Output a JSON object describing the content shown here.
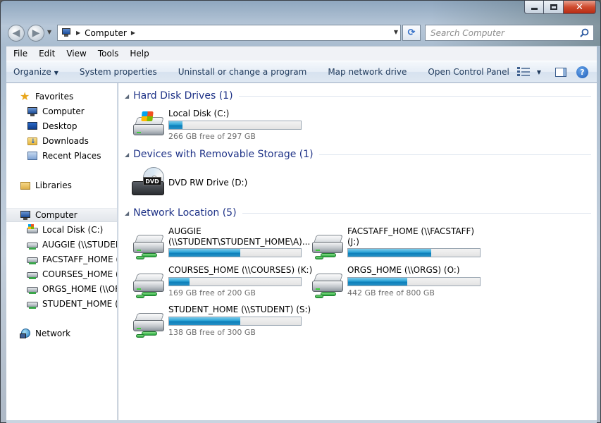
{
  "window": {
    "address": {
      "location": "Computer"
    },
    "search": {
      "placeholder": "Search Computer"
    }
  },
  "menu": [
    "File",
    "Edit",
    "View",
    "Tools",
    "Help"
  ],
  "toolbar": {
    "organize": "Organize",
    "system_properties": "System properties",
    "uninstall": "Uninstall or change a program",
    "map_drive": "Map network drive",
    "control_panel": "Open Control Panel"
  },
  "nav": {
    "favorites": "Favorites",
    "fav_items": [
      "Computer",
      "Desktop",
      "Downloads",
      "Recent Places"
    ],
    "libraries": "Libraries",
    "computer": "Computer",
    "computer_items": [
      "Local Disk (C:)",
      "AUGGIE (\\\\STUDENT",
      "FACSTAFF_HOME (\\\\",
      "COURSES_HOME (\\\\C",
      "ORGS_HOME (\\\\ORG",
      "STUDENT_HOME (\\\\"
    ],
    "network": "Network"
  },
  "groups": {
    "hard_disks": "Hard Disk Drives (1)",
    "removable": "Devices with Removable Storage (1)",
    "network": "Network Location (5)"
  },
  "drives": {
    "local": {
      "name": "Local Disk (C:)",
      "free": "266 GB free of 297 GB",
      "used_fraction": 0.104
    },
    "dvd": {
      "name": "DVD RW Drive (D:)",
      "label": "DVD"
    },
    "auggie": {
      "name_line1": "AUGGIE",
      "name_line2": "(\\\\STUDENT\\STUDENT_HOME\\A)...",
      "used_fraction": 0.54
    },
    "facstaff": {
      "name_line1": "FACSTAFF_HOME (\\\\FACSTAFF)",
      "name_line2": "(J:)",
      "used_fraction": 0.63
    },
    "courses": {
      "name": "COURSES_HOME (\\\\COURSES) (K:)",
      "free": "169 GB free of 200 GB",
      "used_fraction": 0.155
    },
    "orgs": {
      "name": "ORGS_HOME (\\\\ORGS) (O:)",
      "free": "442 GB free of 800 GB",
      "used_fraction": 0.4475
    },
    "student": {
      "name": "STUDENT_HOME (\\\\STUDENT) (S:)",
      "free": "138 GB free of 300 GB",
      "used_fraction": 0.54
    }
  }
}
